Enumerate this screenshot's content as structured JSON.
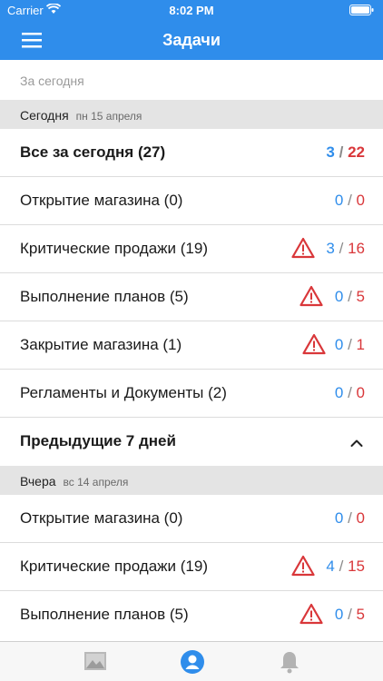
{
  "status_bar": {
    "carrier": "Carrier",
    "time": "8:02 PM"
  },
  "nav": {
    "title": "Задачи",
    "menu_icon": "hamburger-menu-icon"
  },
  "filter": {
    "label": "За сегодня"
  },
  "sections": [
    {
      "day": "Сегодня",
      "date": "пн 15 апреля"
    },
    {
      "day": "Вчера",
      "date": "вс 14 апреля"
    }
  ],
  "today_summary": {
    "label": "Все за сегодня (27)",
    "done": "3",
    "total": "22"
  },
  "today_items": [
    {
      "label": "Открытие магазина (0)",
      "done": "0",
      "total": "0",
      "warning": false
    },
    {
      "label": "Критические продажи (19)",
      "done": "3",
      "total": "16",
      "warning": true
    },
    {
      "label": "Выполнение планов (5)",
      "done": "0",
      "total": "5",
      "warning": true
    },
    {
      "label": "Закрытие магазина (1)",
      "done": "0",
      "total": "1",
      "warning": true
    },
    {
      "label": "Регламенты и Документы (2)",
      "done": "0",
      "total": "0",
      "warning": false
    }
  ],
  "previous": {
    "label": "Предыдущие 7 дней"
  },
  "yesterday_items": [
    {
      "label": "Открытие магазина (0)",
      "done": "0",
      "total": "0",
      "warning": false
    },
    {
      "label": "Критические продажи (19)",
      "done": "4",
      "total": "15",
      "warning": true
    },
    {
      "label": "Выполнение планов (5)",
      "done": "0",
      "total": "5",
      "warning": true
    }
  ],
  "colors": {
    "accent": "#2F8DEB",
    "danger": "#D9373A"
  },
  "tabs": [
    "image-icon",
    "profile-icon",
    "bell-icon"
  ]
}
